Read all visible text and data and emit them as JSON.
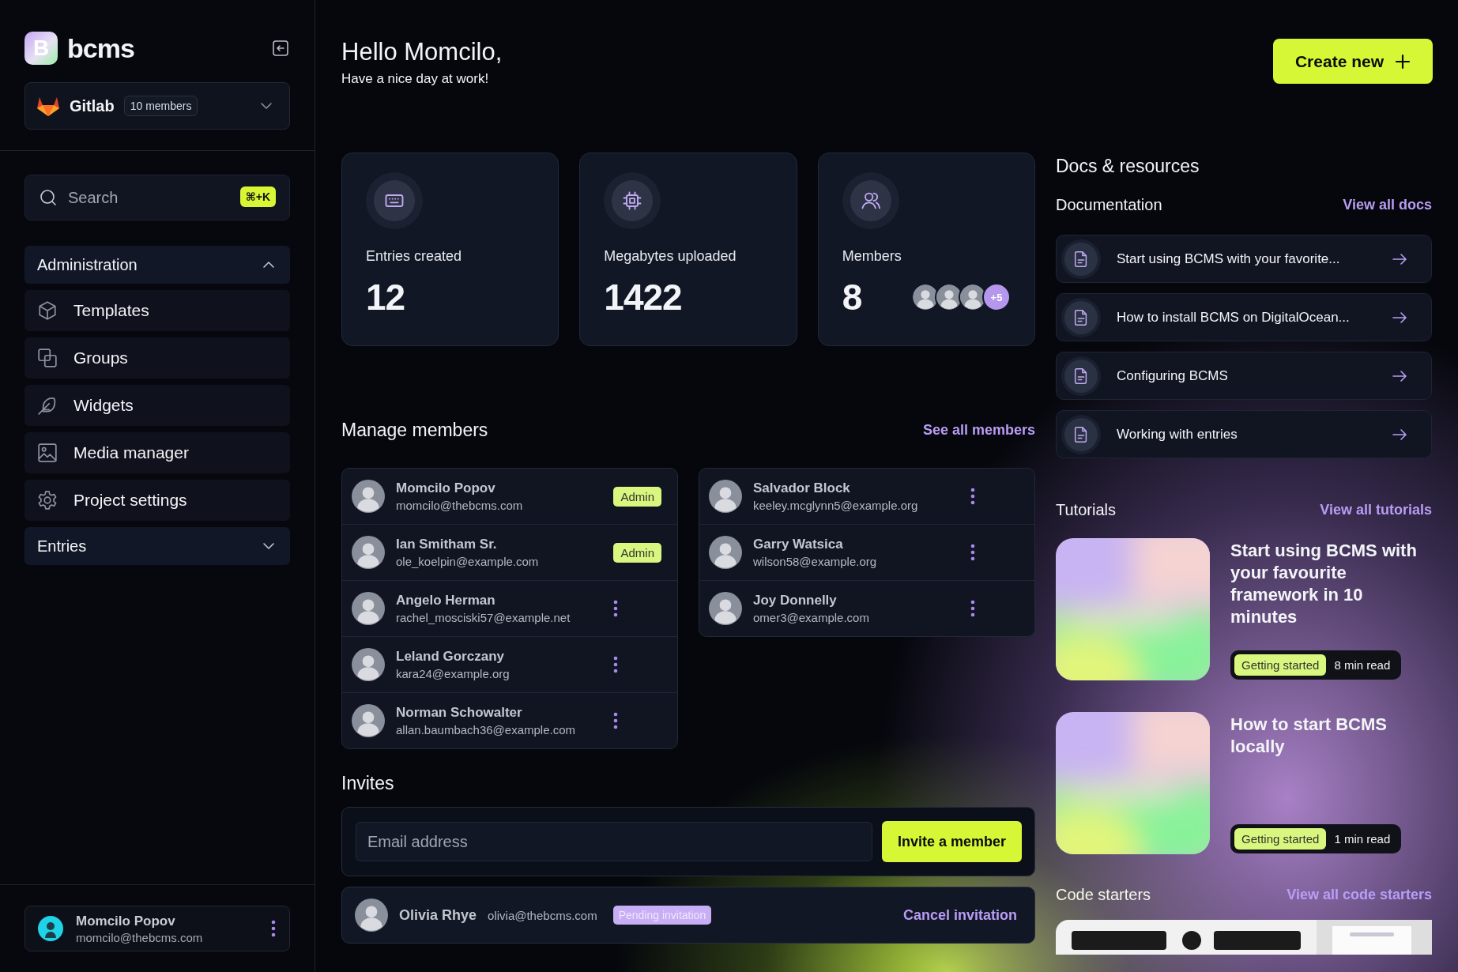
{
  "sidebar": {
    "logo": {
      "letter": "B",
      "name": "bcms"
    },
    "workspace": {
      "name": "Gitlab",
      "badge": "10 members"
    },
    "search": {
      "placeholder": "Search",
      "shortcut": "⌘+K"
    },
    "sections": [
      {
        "title": "Administration",
        "expanded": true,
        "items": [
          {
            "label": "Templates"
          },
          {
            "label": "Groups"
          },
          {
            "label": "Widgets"
          },
          {
            "label": "Media manager"
          },
          {
            "label": "Project settings"
          }
        ]
      },
      {
        "title": "Entries",
        "expanded": false
      }
    ],
    "user": {
      "name": "Momcilo Popov",
      "email": "momcilo@thebcms.com"
    }
  },
  "header": {
    "greeting": "Hello Momcilo,",
    "subtitle": "Have a nice day at work!",
    "create_button": "Create new"
  },
  "stats": [
    {
      "label": "Entries created",
      "value": "12"
    },
    {
      "label": "Megabytes uploaded",
      "value": "1422"
    },
    {
      "label": "Members",
      "value": "8",
      "more": "+5"
    }
  ],
  "members": {
    "title": "Manage members",
    "link": "See all members",
    "columns": [
      [
        {
          "name": "Momcilo Popov",
          "email": "momcilo@thebcms.com",
          "role": "Admin"
        },
        {
          "name": "Ian Smitham Sr.",
          "email": "ole_koelpin@example.com",
          "role": "Admin"
        },
        {
          "name": "Angelo Herman",
          "email": "rachel_mosciski57@example.net"
        },
        {
          "name": "Leland Gorczany",
          "email": "kara24@example.org"
        },
        {
          "name": "Norman Schowalter",
          "email": "allan.baumbach36@example.com"
        }
      ],
      [
        {
          "name": "Salvador Block",
          "email": "keeley.mcglynn5@example.org"
        },
        {
          "name": "Garry Watsica",
          "email": "wilson58@example.org"
        },
        {
          "name": "Joy Donnelly",
          "email": "omer3@example.com"
        }
      ]
    ]
  },
  "invites": {
    "title": "Invites",
    "placeholder": "Email address",
    "button": "Invite a member",
    "pending": [
      {
        "name": "Olivia Rhye",
        "email": "olivia@thebcms.com",
        "status": "Pending invitation",
        "action": "Cancel invitation"
      }
    ]
  },
  "resources": {
    "title": "Docs & resources",
    "documentation": {
      "title": "Documentation",
      "link": "View all docs",
      "items": [
        {
          "title": "Start using BCMS with your favorite..."
        },
        {
          "title": "How to install BCMS on DigitalOcean..."
        },
        {
          "title": "Configuring BCMS"
        },
        {
          "title": "Working with entries"
        }
      ]
    },
    "tutorials": {
      "title": "Tutorials",
      "link": "View all tutorials",
      "items": [
        {
          "title": "Start using BCMS with your favourite framework in 10 minutes",
          "tag": "Getting started",
          "read_time": "8 min read"
        },
        {
          "title": "How to start BCMS locally",
          "tag": "Getting started",
          "read_time": "1 min read"
        }
      ]
    },
    "code_starters": {
      "title": "Code starters",
      "link": "View all code starters"
    }
  }
}
